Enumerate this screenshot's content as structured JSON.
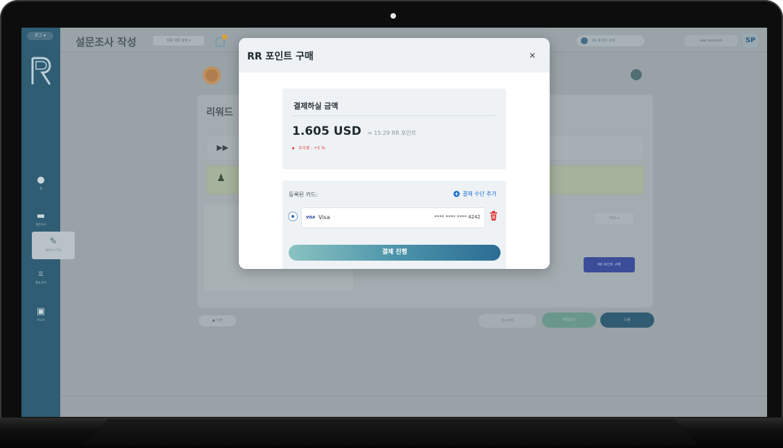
{
  "app": {
    "sidebar_badge": "로그 ▾",
    "page_title": "설문조사 작성",
    "title_chip": "설문 제목 설정 ▾",
    "top_right_chip": "RR 포인트 구매",
    "top_user_chip": "user account",
    "avatar_initials": "SP"
  },
  "sidebar": {
    "items": [
      {
        "icon": "user-icon",
        "label": "홈"
      },
      {
        "icon": "folder-icon",
        "label": "설문조사"
      },
      {
        "icon": "pencil-icon",
        "label": "설문조사 작성"
      },
      {
        "icon": "list-icon",
        "label": "결과 분석"
      },
      {
        "icon": "document-icon",
        "label": "보고서"
      }
    ]
  },
  "background": {
    "card_title": "리워드",
    "row1_icon": "▶▶",
    "small_chip": "PNG ▾",
    "blue_button": "RR 포인트 구매",
    "pill_left": "● 이전",
    "pill_mid": "임시저장",
    "pill_teal": "미리보기",
    "pill_navy": "다음"
  },
  "modal": {
    "title": "RR 포인트 구매",
    "close_label": "×",
    "amount_heading": "결제하실 금액",
    "amount_value": "1.605 USD",
    "amount_approx": "≈ 15.29 RR 포인트",
    "fee_text": "수수료 : +5 %",
    "registered_cards_label": "등록된 카드:",
    "add_method_label": "결제 수단 추가",
    "card": {
      "logo_text": "VISA",
      "brand": "Visa",
      "number_masked": "**** **** **** 4242"
    },
    "pay_button_label": "결제 진행"
  },
  "colors": {
    "primary_blue": "#1d6fd6",
    "fee_red": "#e03b3b",
    "sidebar": "#2f5d74",
    "pay_gradient_start": "#8ac3c1",
    "pay_gradient_end": "#2b6c93"
  }
}
